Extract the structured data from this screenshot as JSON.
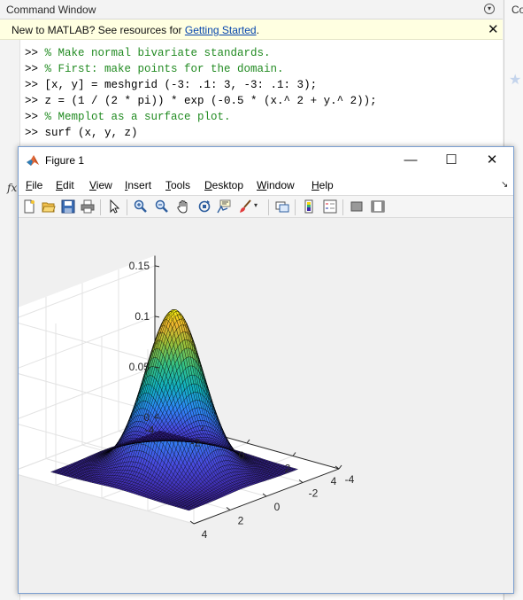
{
  "command_window": {
    "title": "Command Window",
    "banner": {
      "text": "New to MATLAB? See resources for ",
      "link": "Getting Started",
      "suffix": "."
    },
    "lines": [
      {
        "prompt": ">> ",
        "text": "% Make normal bivariate standards.",
        "kind": "comment"
      },
      {
        "prompt": ">> ",
        "text": "% First: make points for the domain.",
        "kind": "comment"
      },
      {
        "prompt": ">> ",
        "text": "[x, y] = meshgrid (-3: .1: 3, -3: .1: 3);",
        "kind": "code"
      },
      {
        "prompt": ">> ",
        "text": "z = (1 / (2 * pi)) * exp (-0.5 * (x.^ 2 + y.^ 2));",
        "kind": "code"
      },
      {
        "prompt": ">> ",
        "text": "% Memplot as a surface plot.",
        "kind": "comment"
      },
      {
        "prompt": ">> ",
        "text": "surf (x, y, z)",
        "kind": "code"
      }
    ],
    "fx": "fx"
  },
  "side_panel": {
    "title": "Co"
  },
  "figure": {
    "title": "Figure 1",
    "menu": [
      "File",
      "Edit",
      "View",
      "Insert",
      "Tools",
      "Desktop",
      "Window",
      "Help"
    ],
    "toolbar_icons": [
      "new-figure-icon",
      "open-file-icon",
      "save-icon",
      "print-icon",
      "select-arrow-icon",
      "zoom-in-icon",
      "zoom-out-icon",
      "pan-icon",
      "rotate-3d-icon",
      "data-cursor-icon",
      "brush-icon",
      "brush-dropdown-icon",
      "link-plot-icon",
      "colorbar-icon",
      "legend-icon",
      "hide-plot-tools-icon",
      "show-plot-tools-icon"
    ]
  },
  "chart_data": {
    "type": "surface",
    "function": "z = (1/(2*pi)) * exp(-0.5*(x^2 + y^2))",
    "x_range": [
      -3,
      3
    ],
    "y_range": [
      -3,
      3
    ],
    "step": 0.1,
    "xlim": [
      -4,
      4
    ],
    "ylim": [
      -4,
      4
    ],
    "zlim": [
      0,
      0.16
    ],
    "x_ticks": [
      -4,
      -2,
      0,
      2,
      4
    ],
    "y_ticks": [
      -4,
      -2,
      0,
      2,
      4
    ],
    "z_ticks": [
      0,
      0.05,
      0.1,
      0.15
    ],
    "x_tick_labels": [
      "-4",
      "-2",
      "0",
      "2",
      "4"
    ],
    "y_tick_labels": [
      "-4",
      "-2",
      "0",
      "2",
      "4"
    ],
    "z_tick_labels": [
      "0",
      "0.05",
      "0.1",
      "0.15"
    ],
    "peak": {
      "x": 0,
      "y": 0,
      "z": 0.159
    },
    "colormap": "parula",
    "grid": true,
    "colors": {
      "low": "#3e26a8",
      "mid": "#12b0c0",
      "high": "#f9fb0e"
    }
  }
}
